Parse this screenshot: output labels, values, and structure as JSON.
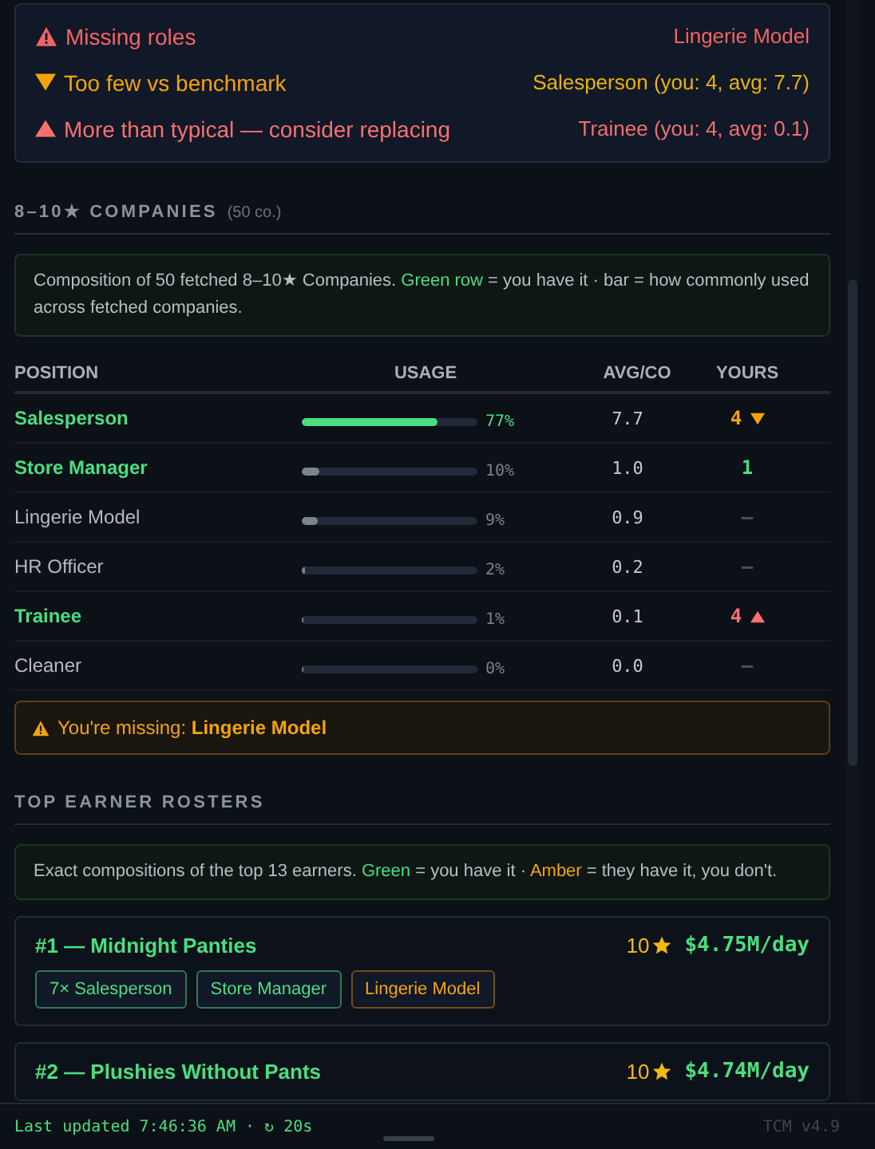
{
  "alerts": [
    {
      "kind": "missing",
      "label": "Missing roles",
      "detail": "Lingerie Model"
    },
    {
      "kind": "low",
      "label": "Too few vs benchmark",
      "detail": "Salesperson (you: 4, avg: 7.7)"
    },
    {
      "kind": "high",
      "label": "More than typical — consider replacing",
      "detail": "Trainee (you: 4, avg: 0.1)"
    }
  ],
  "companies": {
    "title": "8–10★ COMPANIES",
    "count": "(50 co.)",
    "note": [
      {
        "text": "Composition of 50 fetched 8–10★ Companies. "
      },
      {
        "text": "Green row",
        "color": "#4ade80"
      },
      {
        "text": " = you have it · bar = how commonly used across fetched companies."
      }
    ],
    "columns": [
      "POSITION",
      "USAGE",
      "AVG/CO",
      "YOURS"
    ],
    "rows": [
      {
        "position": "Salesperson",
        "have": true,
        "level": 0.77,
        "usage": "77%",
        "avg": "7.7",
        "yours": "4",
        "kind": "below"
      },
      {
        "position": "Store Manager",
        "have": true,
        "level": 0.1,
        "usage": "10%",
        "avg": "1.0",
        "yours": "1",
        "kind": "normal"
      },
      {
        "position": "Lingerie Model",
        "have": false,
        "level": 0.09,
        "usage": "9%",
        "avg": "0.9",
        "yours": "—",
        "kind": "normal"
      },
      {
        "position": "HR Officer",
        "have": false,
        "level": 0.02,
        "usage": "2%",
        "avg": "0.2",
        "yours": "—",
        "kind": "normal"
      },
      {
        "position": "Trainee",
        "have": true,
        "level": 0.01,
        "usage": "1%",
        "avg": "0.1",
        "yours": "4",
        "kind": "above"
      },
      {
        "position": "Cleaner",
        "have": false,
        "level": 0,
        "usage": "0%",
        "avg": "0.0",
        "yours": "—",
        "kind": "normal"
      }
    ],
    "missing": {
      "label": "You're missing: ",
      "roles": "Lingerie Model"
    }
  },
  "rosters": {
    "title": "TOP EARNER ROSTERS",
    "note": [
      {
        "text": "Exact compositions of the top 13 earners. "
      },
      {
        "text": "Green",
        "color": "#4ade80"
      },
      {
        "text": " = you have it · "
      },
      {
        "text": "Amber",
        "color": "#f5a30b"
      },
      {
        "text": " = they have it, you don't."
      }
    ],
    "cards": [
      {
        "title": "#1 — Midnight Panties",
        "rating": "10",
        "income": "$4.75M/day",
        "roles": [
          {
            "label": "7× Salesperson",
            "have": true
          },
          {
            "label": "Store Manager",
            "have": true
          },
          {
            "label": "Lingerie Model",
            "have": false
          }
        ]
      },
      {
        "title": "#2 — Plushies Without Pants",
        "rating": "10",
        "income": "$4.74M/day"
      }
    ]
  },
  "footer": {
    "updated": "Last updated 7:46:36 AM · ↻ 20s",
    "version": "TCM v4.9"
  }
}
